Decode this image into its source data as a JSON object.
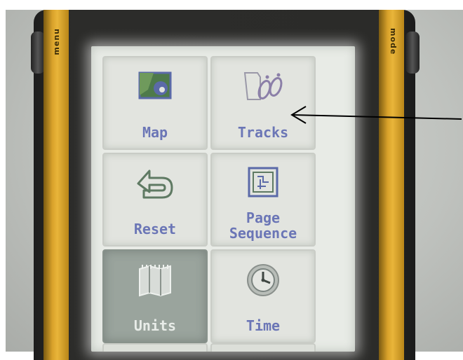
{
  "device": {
    "left_button_label": "menu",
    "right_button_label": "mode"
  },
  "menu": {
    "tiles": [
      {
        "label_lines": [
          "Map"
        ],
        "icon": "map-icon",
        "selected": false
      },
      {
        "label_lines": [
          "Tracks"
        ],
        "icon": "footprints-icon",
        "selected": false
      },
      {
        "label_lines": [
          "Reset"
        ],
        "icon": "reset-arrow-icon",
        "selected": false
      },
      {
        "label_lines": [
          "Page",
          "Sequence"
        ],
        "icon": "page-sequence-icon",
        "selected": false
      },
      {
        "label_lines": [
          "Units"
        ],
        "icon": "ruler-map-icon",
        "selected": true
      },
      {
        "label_lines": [
          "Time"
        ],
        "icon": "clock-icon",
        "selected": false
      }
    ]
  },
  "annotation": {
    "target": "Tracks",
    "color": "#000000"
  },
  "colors": {
    "label_text": "#6b76b6",
    "selected_tile": "#9aa49d",
    "device_trim": "#e0a933"
  }
}
